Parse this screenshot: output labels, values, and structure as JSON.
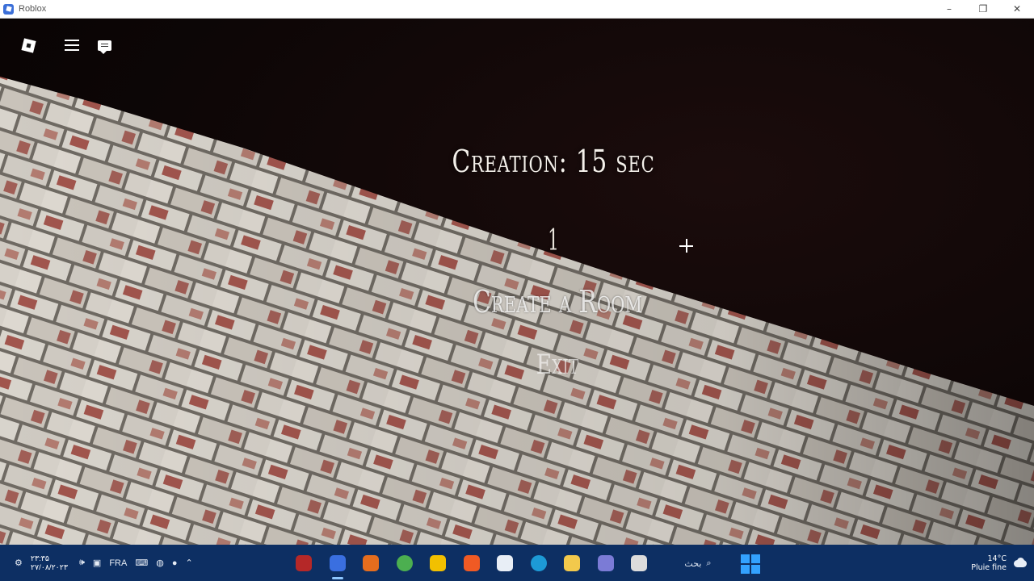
{
  "window": {
    "title": "Roblox",
    "minimize_glyph": "–",
    "maximize_glyph": "❐",
    "close_glyph": "✕"
  },
  "game_ui": {
    "creation_timer": "Creation: 15 sec",
    "counter": "1",
    "create_room": "Create a Room",
    "exit": "Exit"
  },
  "taskbar": {
    "clock_time": "۲۳:۳۵",
    "clock_date": "۲۷/۰۸/۲۰۲۳",
    "language": "FRA",
    "search_label": "بحث",
    "search_glyph": "⌕",
    "weather_temp": "14°C",
    "weather_desc": "Pluie fine",
    "speaker_glyph": "🕪",
    "chevron_glyph": "⌃",
    "apps": [
      {
        "name": "chrome-alt-icon",
        "color": "#b52828"
      },
      {
        "name": "roblox-icon",
        "color": "#3a6fe0"
      },
      {
        "name": "vlc-icon",
        "color": "#e56d1e"
      },
      {
        "name": "chrome-icon",
        "color": "#4caf50"
      },
      {
        "name": "norton-icon",
        "color": "#f2c000"
      },
      {
        "name": "brave-icon",
        "color": "#f05a24"
      },
      {
        "name": "calculator-icon",
        "color": "#e8eef6"
      },
      {
        "name": "edge-icon",
        "color": "#1d9ad6"
      },
      {
        "name": "file-explorer-icon",
        "color": "#f2c94c"
      },
      {
        "name": "store-icon",
        "color": "#7b7bd6"
      },
      {
        "name": "notepad-icon",
        "color": "#dcdcdc"
      }
    ]
  },
  "colors": {
    "taskbar_bg": "#0d2f63",
    "title_text": "#f4f0ea",
    "accent_blue": "#33a2ff"
  }
}
